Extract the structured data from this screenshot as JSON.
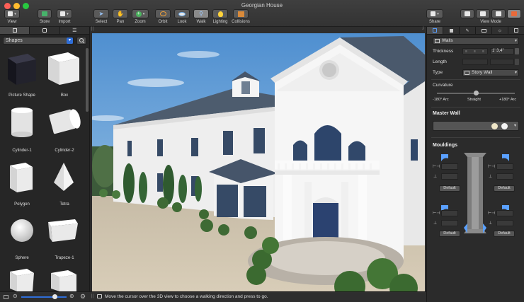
{
  "window": {
    "title": "Georgian House"
  },
  "toolbar": {
    "view_label": "View",
    "store_label": "Store",
    "import_label": "Import",
    "select_label": "Select",
    "pan_label": "Pan",
    "zoom_label": "Zoom",
    "orbit_label": "Orbit",
    "look_label": "Look",
    "walk_label": "Walk",
    "lighting_label": "Lighting",
    "collisions_label": "Collisions",
    "share_label": "Share",
    "view_mode_label": "View Mode"
  },
  "library": {
    "category": "Shapes",
    "items": [
      {
        "label": "Picture Shape"
      },
      {
        "label": "Box"
      },
      {
        "label": "Cylinder-1"
      },
      {
        "label": "Cylinder-2"
      },
      {
        "label": "Polygon"
      },
      {
        "label": "Tetra"
      },
      {
        "label": "Sphere"
      },
      {
        "label": "Trapeze-1"
      },
      {
        "label": ""
      },
      {
        "label": ""
      }
    ]
  },
  "status": {
    "message": "Move the cursor over the 3D view to choose a walking direction and press to go."
  },
  "inspector": {
    "object_type": "Walls",
    "thickness_label": "Thickness",
    "thickness_value": "1' 3,4\"",
    "length_label": "Length",
    "type_label": "Type",
    "type_value": "Story Wall",
    "curvature_label": "Curvature",
    "curvature_min": "-180° Arc",
    "curvature_mid": "Straight",
    "curvature_max": "+180° Arc",
    "curvature_value": 0.5,
    "master_wall_label": "Master Wall",
    "mouldings_label": "Mouldings",
    "default_label": "Default"
  },
  "colors": {
    "accent": "#2f6ed8",
    "toolbar_bg": "#3a3a3a",
    "panel_bg": "#2b2b2b"
  }
}
